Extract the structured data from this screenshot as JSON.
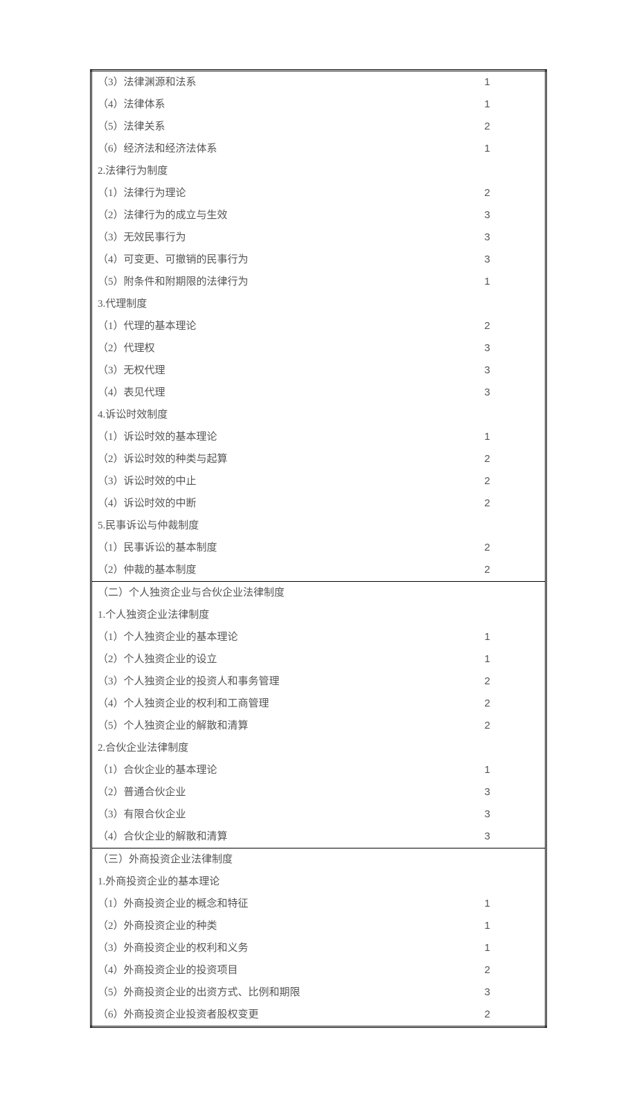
{
  "sections": [
    {
      "rows": [
        {
          "label": "（3）法律渊源和法系",
          "value": "1"
        },
        {
          "label": "（4）法律体系",
          "value": "1"
        },
        {
          "label": "（5）法律关系",
          "value": "2"
        },
        {
          "label": "（6）经济法和经济法体系",
          "value": "1"
        },
        {
          "label": "2.法律行为制度",
          "value": ""
        },
        {
          "label": "（1）法律行为理论",
          "value": "2"
        },
        {
          "label": "（2）法律行为的成立与生效",
          "value": "3"
        },
        {
          "label": "（3）无效民事行为",
          "value": "3"
        },
        {
          "label": "（4）可变更、可撤销的民事行为",
          "value": "3"
        },
        {
          "label": "（5）附条件和附期限的法律行为",
          "value": "1"
        },
        {
          "label": "3.代理制度",
          "value": ""
        },
        {
          "label": "（1）代理的基本理论",
          "value": "2"
        },
        {
          "label": "（2）代理权",
          "value": "3"
        },
        {
          "label": "（3）无权代理",
          "value": "3"
        },
        {
          "label": "（4）表见代理",
          "value": "3"
        },
        {
          "label": "4.诉讼时效制度",
          "value": ""
        },
        {
          "label": "（1）诉讼时效的基本理论",
          "value": "1"
        },
        {
          "label": "（2）诉讼时效的种类与起算",
          "value": "2"
        },
        {
          "label": "（3）诉讼时效的中止",
          "value": "2"
        },
        {
          "label": "（4）诉讼时效的中断",
          "value": "2"
        },
        {
          "label": "5.民事诉讼与仲裁制度",
          "value": ""
        },
        {
          "label": "（1）民事诉讼的基本制度",
          "value": "2"
        },
        {
          "label": "（2）仲裁的基本制度",
          "value": "2"
        }
      ]
    },
    {
      "rows": [
        {
          "label": "（二）个人独资企业与合伙企业法律制度",
          "value": ""
        },
        {
          "label": "1.个人独资企业法律制度",
          "value": ""
        },
        {
          "label": "（1）个人独资企业的基本理论",
          "value": "1"
        },
        {
          "label": "（2）个人独资企业的设立",
          "value": "1"
        },
        {
          "label": "（3）个人独资企业的投资人和事务管理",
          "value": "2"
        },
        {
          "label": "（4）个人独资企业的权利和工商管理",
          "value": "2"
        },
        {
          "label": "（5）个人独资企业的解散和清算",
          "value": "2"
        },
        {
          "label": "2.合伙企业法律制度",
          "value": ""
        },
        {
          "label": "（1）合伙企业的基本理论",
          "value": "1"
        },
        {
          "label": "（2）普通合伙企业",
          "value": "3"
        },
        {
          "label": "（3）有限合伙企业",
          "value": "3"
        },
        {
          "label": "（4）合伙企业的解散和清算",
          "value": "3"
        }
      ]
    },
    {
      "rows": [
        {
          "label": "（三）外商投资企业法律制度",
          "value": ""
        },
        {
          "label": "1.外商投资企业的基本理论",
          "value": ""
        },
        {
          "label": "（1）外商投资企业的概念和特征",
          "value": "1"
        },
        {
          "label": "（2）外商投资企业的种类",
          "value": "1"
        },
        {
          "label": "（3）外商投资企业的权利和义务",
          "value": "1"
        },
        {
          "label": "（4）外商投资企业的投资项目",
          "value": "2"
        },
        {
          "label": "（5）外商投资企业的出资方式、比例和期限",
          "value": "3"
        },
        {
          "label": "（6）外商投资企业投资者股权变更",
          "value": "2"
        }
      ]
    }
  ]
}
